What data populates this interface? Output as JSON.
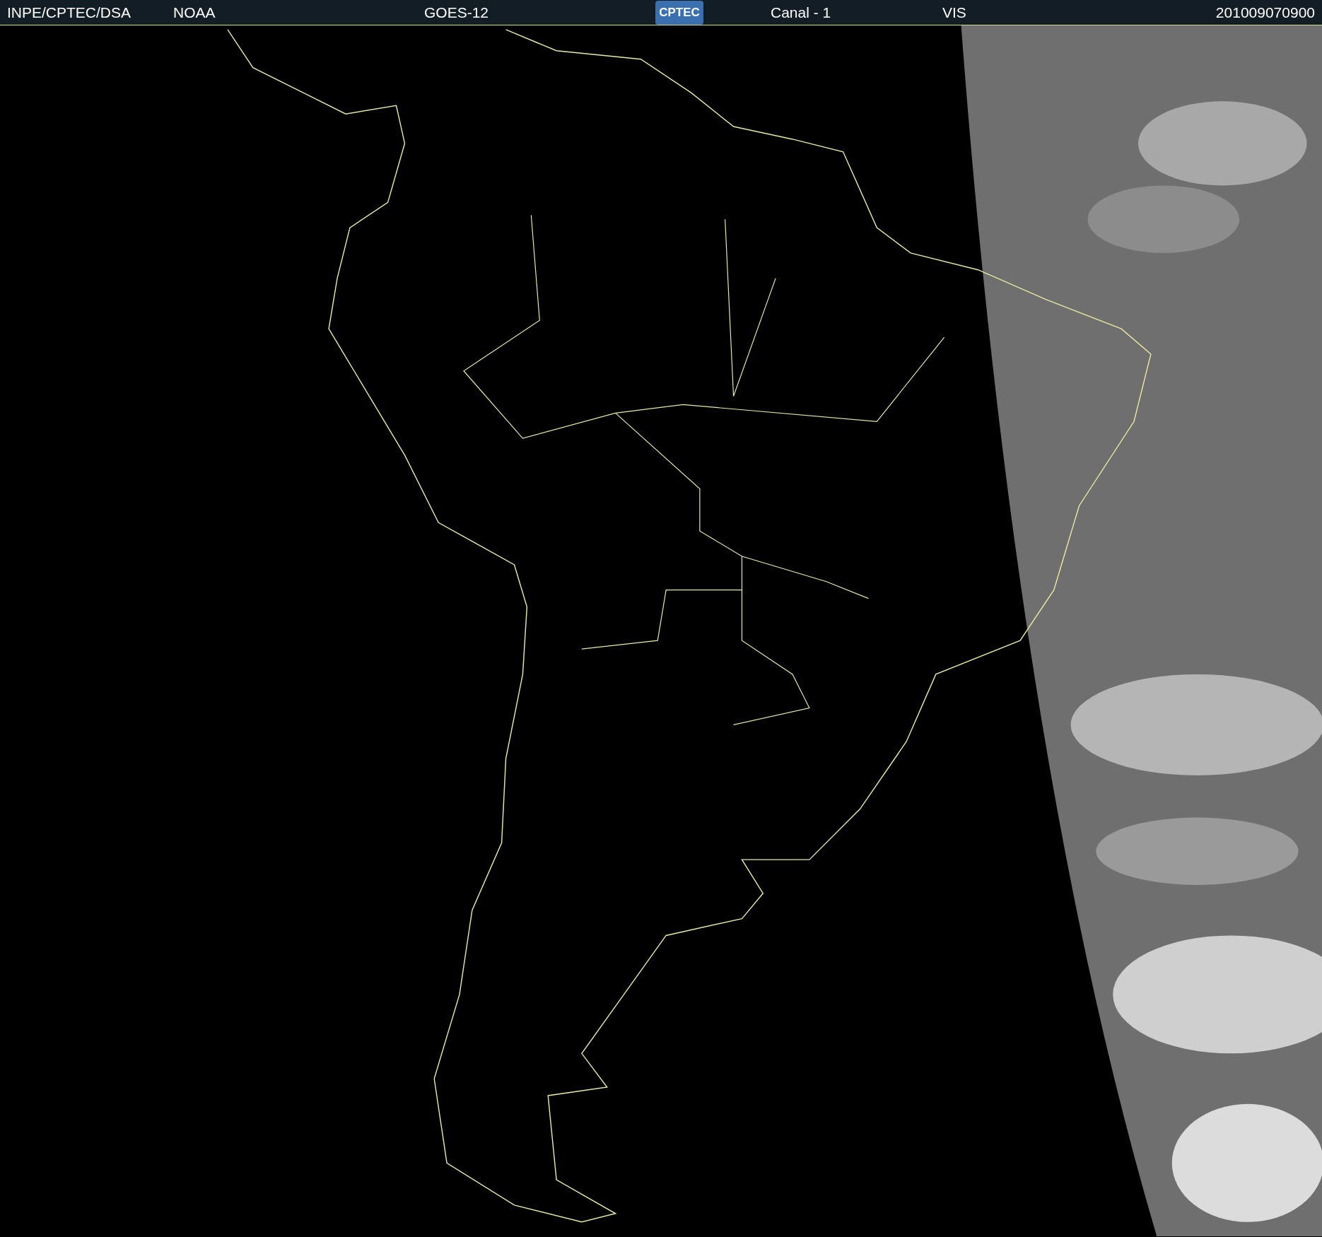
{
  "header": {
    "source": "INPE/CPTEC/DSA",
    "agency": "NOAA",
    "satellite": "GOES-12",
    "logo": "CPTEC",
    "channel": "Canal - 1",
    "band": "VIS",
    "timestamp": "201009070900"
  }
}
